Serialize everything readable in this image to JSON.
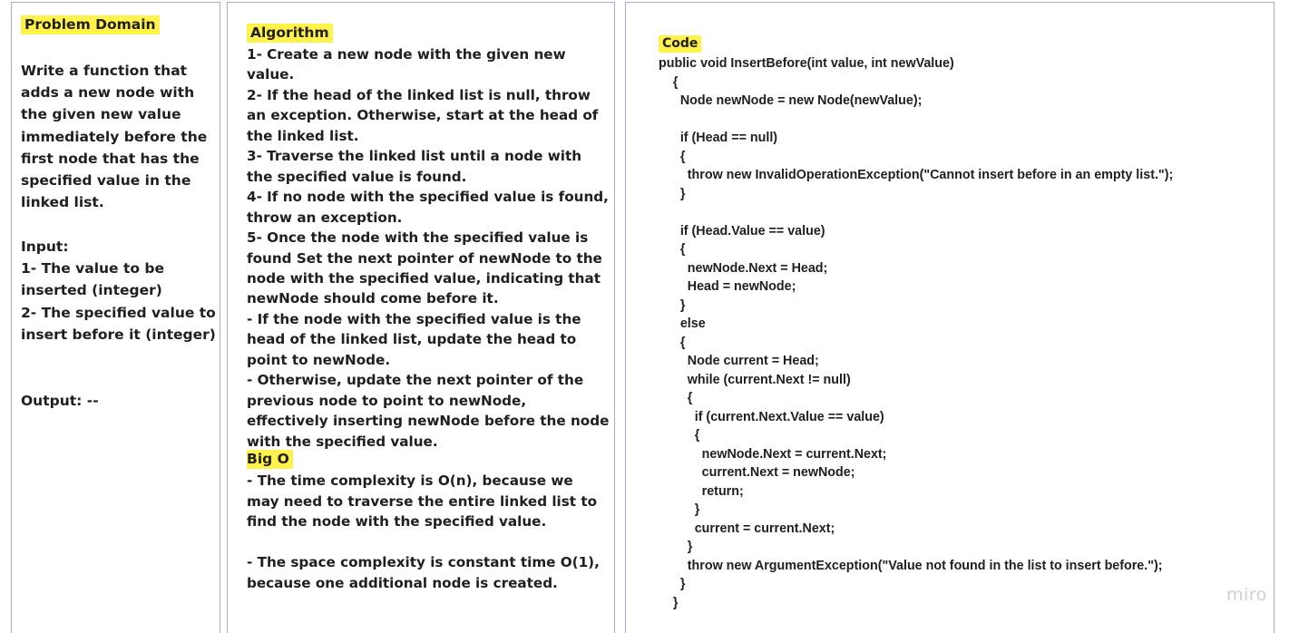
{
  "problem_domain": {
    "heading": "Problem Domain",
    "description": " Write a function that adds a new node with the given new value immediately before the first node that has the specified value in the linked list.",
    "input": "Input:\n1- The value to be inserted (integer)\n2- The specified value to insert before it (integer)",
    "output": "Output: --"
  },
  "algorithm": {
    "heading": "Algorithm",
    "steps": "1- Create a new node with the given new value.\n2- If the head of the linked list is null, throw an exception. Otherwise, start at the head of the linked list.\n3- Traverse the linked list until a node with the specified value is found.\n4- If no node with the specified value is found, throw an exception.\n5- Once the node with the specified value is found Set the next pointer of newNode to the node with the specified value, indicating that newNode should come before it.\n- If the node with the specified value is the head of the linked list, update the head to point to newNode.\n- Otherwise, update the next pointer of the previous node to point to newNode, effectively inserting newNode before the node with the specified value.",
    "big_o_heading": "Big O",
    "big_o": "- The time complexity is O(n), because we may need to traverse the entire linked list to find the node with the specified value.\n\n- The space complexity is constant time O(1), because one additional node is created."
  },
  "code": {
    "heading": "Code",
    "lines": [
      "public void InsertBefore(int value, int newValue)",
      "    {",
      "      Node newNode = new Node(newValue);",
      "",
      "      if (Head == null)",
      "      {",
      "        throw new InvalidOperationException(\"Cannot insert before in an empty list.\");",
      "      }",
      "",
      "      if (Head.Value == value)",
      "      {",
      "        newNode.Next = Head;",
      "        Head = newNode;",
      "      }",
      "      else",
      "      {",
      "        Node current = Head;",
      "        while (current.Next != null)",
      "        {",
      "          if (current.Next.Value == value)",
      "          {",
      "            newNode.Next = current.Next;",
      "            current.Next = newNode;",
      "            return;",
      "          }",
      "          current = current.Next;",
      "        }",
      "        throw new ArgumentException(\"Value not found in the list to insert before.\");",
      "      }",
      "    }"
    ]
  },
  "watermark": "miro",
  "colors": {
    "highlight": "#fff24a",
    "panel_border": "#a9abd6"
  }
}
